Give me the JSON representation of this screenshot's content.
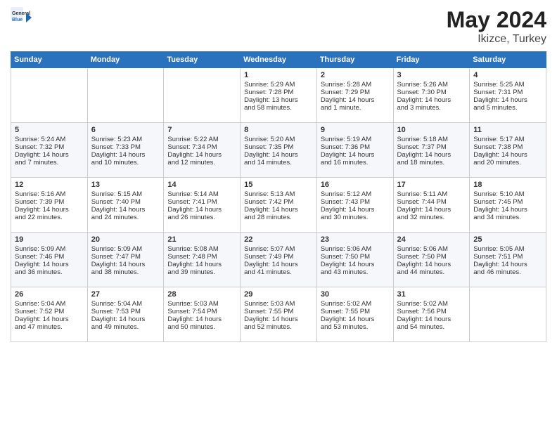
{
  "header": {
    "logo_general": "General",
    "logo_blue": "Blue",
    "month_year": "May 2024",
    "location": "Ikizce, Turkey"
  },
  "weekdays": [
    "Sunday",
    "Monday",
    "Tuesday",
    "Wednesday",
    "Thursday",
    "Friday",
    "Saturday"
  ],
  "weeks": [
    [
      {
        "day": "",
        "info": ""
      },
      {
        "day": "",
        "info": ""
      },
      {
        "day": "",
        "info": ""
      },
      {
        "day": "1",
        "info": "Sunrise: 5:29 AM\nSunset: 7:28 PM\nDaylight: 13 hours\nand 58 minutes."
      },
      {
        "day": "2",
        "info": "Sunrise: 5:28 AM\nSunset: 7:29 PM\nDaylight: 14 hours\nand 1 minute."
      },
      {
        "day": "3",
        "info": "Sunrise: 5:26 AM\nSunset: 7:30 PM\nDaylight: 14 hours\nand 3 minutes."
      },
      {
        "day": "4",
        "info": "Sunrise: 5:25 AM\nSunset: 7:31 PM\nDaylight: 14 hours\nand 5 minutes."
      }
    ],
    [
      {
        "day": "5",
        "info": "Sunrise: 5:24 AM\nSunset: 7:32 PM\nDaylight: 14 hours\nand 7 minutes."
      },
      {
        "day": "6",
        "info": "Sunrise: 5:23 AM\nSunset: 7:33 PM\nDaylight: 14 hours\nand 10 minutes."
      },
      {
        "day": "7",
        "info": "Sunrise: 5:22 AM\nSunset: 7:34 PM\nDaylight: 14 hours\nand 12 minutes."
      },
      {
        "day": "8",
        "info": "Sunrise: 5:20 AM\nSunset: 7:35 PM\nDaylight: 14 hours\nand 14 minutes."
      },
      {
        "day": "9",
        "info": "Sunrise: 5:19 AM\nSunset: 7:36 PM\nDaylight: 14 hours\nand 16 minutes."
      },
      {
        "day": "10",
        "info": "Sunrise: 5:18 AM\nSunset: 7:37 PM\nDaylight: 14 hours\nand 18 minutes."
      },
      {
        "day": "11",
        "info": "Sunrise: 5:17 AM\nSunset: 7:38 PM\nDaylight: 14 hours\nand 20 minutes."
      }
    ],
    [
      {
        "day": "12",
        "info": "Sunrise: 5:16 AM\nSunset: 7:39 PM\nDaylight: 14 hours\nand 22 minutes."
      },
      {
        "day": "13",
        "info": "Sunrise: 5:15 AM\nSunset: 7:40 PM\nDaylight: 14 hours\nand 24 minutes."
      },
      {
        "day": "14",
        "info": "Sunrise: 5:14 AM\nSunset: 7:41 PM\nDaylight: 14 hours\nand 26 minutes."
      },
      {
        "day": "15",
        "info": "Sunrise: 5:13 AM\nSunset: 7:42 PM\nDaylight: 14 hours\nand 28 minutes."
      },
      {
        "day": "16",
        "info": "Sunrise: 5:12 AM\nSunset: 7:43 PM\nDaylight: 14 hours\nand 30 minutes."
      },
      {
        "day": "17",
        "info": "Sunrise: 5:11 AM\nSunset: 7:44 PM\nDaylight: 14 hours\nand 32 minutes."
      },
      {
        "day": "18",
        "info": "Sunrise: 5:10 AM\nSunset: 7:45 PM\nDaylight: 14 hours\nand 34 minutes."
      }
    ],
    [
      {
        "day": "19",
        "info": "Sunrise: 5:09 AM\nSunset: 7:46 PM\nDaylight: 14 hours\nand 36 minutes."
      },
      {
        "day": "20",
        "info": "Sunrise: 5:09 AM\nSunset: 7:47 PM\nDaylight: 14 hours\nand 38 minutes."
      },
      {
        "day": "21",
        "info": "Sunrise: 5:08 AM\nSunset: 7:48 PM\nDaylight: 14 hours\nand 39 minutes."
      },
      {
        "day": "22",
        "info": "Sunrise: 5:07 AM\nSunset: 7:49 PM\nDaylight: 14 hours\nand 41 minutes."
      },
      {
        "day": "23",
        "info": "Sunrise: 5:06 AM\nSunset: 7:50 PM\nDaylight: 14 hours\nand 43 minutes."
      },
      {
        "day": "24",
        "info": "Sunrise: 5:06 AM\nSunset: 7:50 PM\nDaylight: 14 hours\nand 44 minutes."
      },
      {
        "day": "25",
        "info": "Sunrise: 5:05 AM\nSunset: 7:51 PM\nDaylight: 14 hours\nand 46 minutes."
      }
    ],
    [
      {
        "day": "26",
        "info": "Sunrise: 5:04 AM\nSunset: 7:52 PM\nDaylight: 14 hours\nand 47 minutes."
      },
      {
        "day": "27",
        "info": "Sunrise: 5:04 AM\nSunset: 7:53 PM\nDaylight: 14 hours\nand 49 minutes."
      },
      {
        "day": "28",
        "info": "Sunrise: 5:03 AM\nSunset: 7:54 PM\nDaylight: 14 hours\nand 50 minutes."
      },
      {
        "day": "29",
        "info": "Sunrise: 5:03 AM\nSunset: 7:55 PM\nDaylight: 14 hours\nand 52 minutes."
      },
      {
        "day": "30",
        "info": "Sunrise: 5:02 AM\nSunset: 7:55 PM\nDaylight: 14 hours\nand 53 minutes."
      },
      {
        "day": "31",
        "info": "Sunrise: 5:02 AM\nSunset: 7:56 PM\nDaylight: 14 hours\nand 54 minutes."
      },
      {
        "day": "",
        "info": ""
      }
    ]
  ]
}
